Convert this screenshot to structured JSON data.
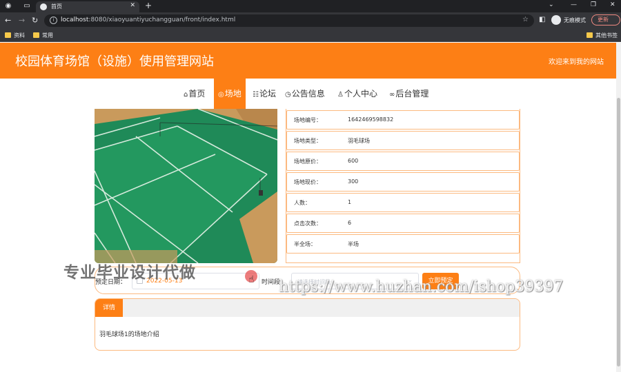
{
  "browser": {
    "tab_title": "首页",
    "url_host": "localhost",
    "url_rest": ":8080/xiaoyuantiyuchangguan/front/index.html",
    "incognito_label": "无痕模式",
    "update_label": "更新",
    "bookmarks": [
      "资料",
      "常用"
    ],
    "other_bookmarks": "其他书签"
  },
  "site": {
    "title": "校园体育场馆（设施）使用管理网站",
    "welcome": "欢迎来到我的网站"
  },
  "nav": [
    {
      "icon": "⌂",
      "label": "首页",
      "active": false
    },
    {
      "icon": "◎",
      "label": "场地",
      "active": true
    },
    {
      "icon": "☷",
      "label": "论坛",
      "active": false
    },
    {
      "icon": "◷",
      "label": "公告信息",
      "active": false
    },
    {
      "icon": "♙",
      "label": "个人中心",
      "active": false
    },
    {
      "icon": "∞",
      "label": "后台管理",
      "active": false
    }
  ],
  "venue": {
    "details": [
      {
        "key": "场地编号：",
        "value": "1642469598832"
      },
      {
        "key": "场地类型：",
        "value": "羽毛球场"
      },
      {
        "key": "场地原价：",
        "value": "600"
      },
      {
        "key": "场地现价：",
        "value": "300"
      },
      {
        "key": "人数：",
        "value": "1"
      },
      {
        "key": "点击次数：",
        "value": "6"
      },
      {
        "key": "半全场：",
        "value": "半场"
      }
    ]
  },
  "booking": {
    "date_label": "预定日期：",
    "date_value": "2022-05-13",
    "time_label": "时间段：",
    "time_placeholder": "请选择时间段",
    "submit_label": "立即预定"
  },
  "intro": {
    "tab_label": "详情",
    "text": "羽毛球场1的场地介绍"
  },
  "watermarks": {
    "left": "专业毕业设计代做",
    "right": "https://www.huzhan.com/ishop39397"
  },
  "colors": {
    "accent": "#fd7f15",
    "border": "#fcb97f"
  }
}
